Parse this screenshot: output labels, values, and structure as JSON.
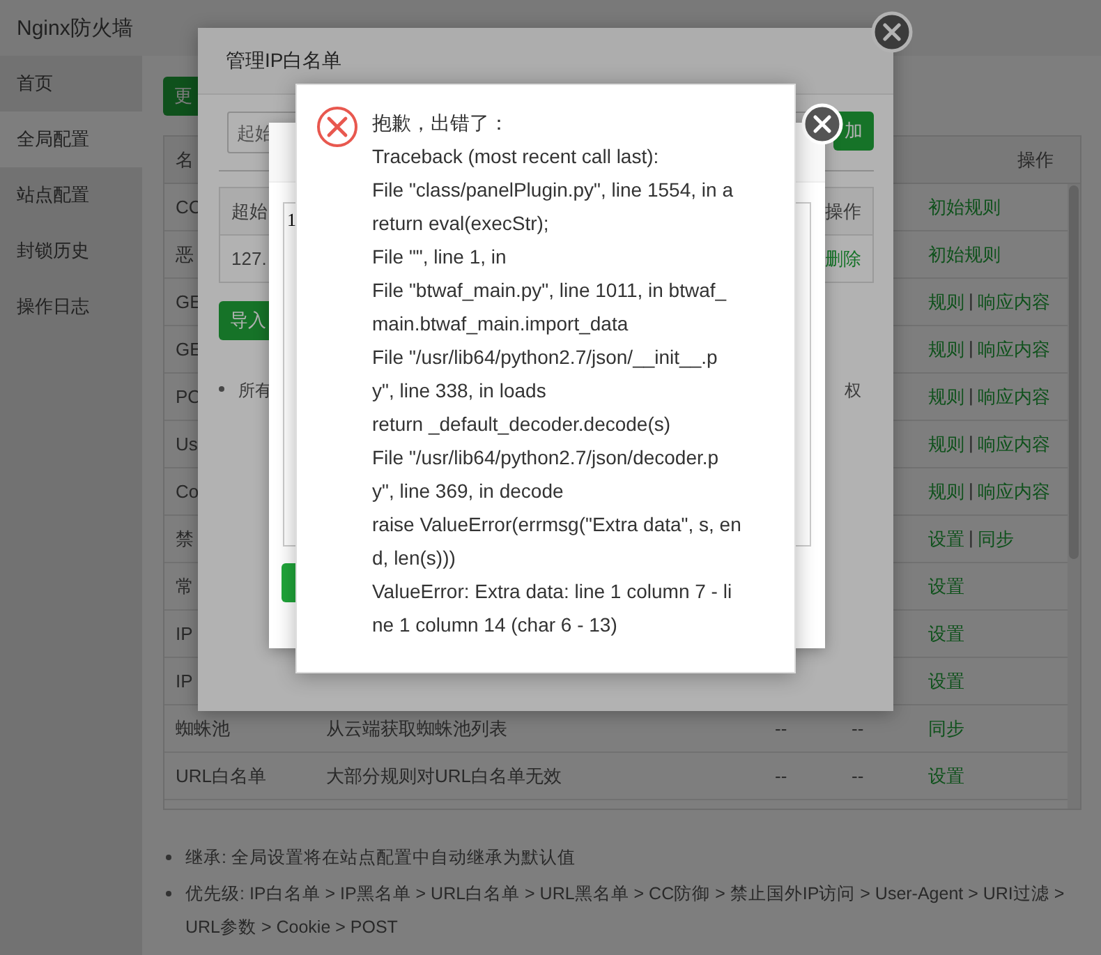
{
  "app_title": "Nginx防火墙",
  "sidebar": {
    "items": [
      {
        "label": "首页",
        "selected": false
      },
      {
        "label": "全局配置",
        "selected": true
      },
      {
        "label": "站点配置",
        "selected": false
      },
      {
        "label": "封锁历史",
        "selected": false
      },
      {
        "label": "操作日志",
        "selected": false
      }
    ]
  },
  "main": {
    "toolbar_button": "更",
    "table": {
      "columns": [
        "名",
        "操作"
      ],
      "rows": [
        {
          "name": "CC",
          "actions": [
            {
              "kind": "link",
              "label": "初始规则"
            }
          ]
        },
        {
          "name": "恶",
          "actions": [
            {
              "kind": "link",
              "label": "初始规则"
            }
          ]
        },
        {
          "name": "GE",
          "actions": [
            {
              "kind": "link",
              "label": "规则"
            },
            {
              "kind": "separator",
              "label": "|"
            },
            {
              "kind": "link",
              "label": "响应内容"
            }
          ]
        },
        {
          "name": "GE",
          "actions": [
            {
              "kind": "link",
              "label": "规则"
            },
            {
              "kind": "separator",
              "label": "|"
            },
            {
              "kind": "link",
              "label": "响应内容"
            }
          ]
        },
        {
          "name": "PO",
          "actions": [
            {
              "kind": "link",
              "label": "规则"
            },
            {
              "kind": "separator",
              "label": "|"
            },
            {
              "kind": "link",
              "label": "响应内容"
            }
          ]
        },
        {
          "name": "Us",
          "actions": [
            {
              "kind": "link",
              "label": "规则"
            },
            {
              "kind": "separator",
              "label": "|"
            },
            {
              "kind": "link",
              "label": "响应内容"
            }
          ]
        },
        {
          "name": "Co",
          "actions": [
            {
              "kind": "link",
              "label": "规则"
            },
            {
              "kind": "separator",
              "label": "|"
            },
            {
              "kind": "link",
              "label": "响应内容"
            }
          ]
        },
        {
          "name": "禁",
          "actions": [
            {
              "kind": "link",
              "label": "设置"
            },
            {
              "kind": "separator",
              "label": "|"
            },
            {
              "kind": "link",
              "label": "同步"
            }
          ]
        },
        {
          "name": "常",
          "actions": [
            {
              "kind": "link",
              "label": "设置"
            }
          ]
        },
        {
          "name": "IP",
          "actions": [
            {
              "kind": "link",
              "label": "设置"
            }
          ]
        },
        {
          "name": "IP",
          "actions": [
            {
              "kind": "link",
              "label": "设置"
            }
          ]
        },
        {
          "name": "蜘蛛池",
          "description": "从云端获取蜘蛛池列表",
          "column_3": "--",
          "column_4": "--",
          "actions": [
            {
              "kind": "link",
              "label": "同步"
            }
          ]
        },
        {
          "name": "URL白名单",
          "description": "大部分规则对URL白名单无效",
          "column_3": "--",
          "column_4": "--",
          "actions": [
            {
              "kind": "link",
              "label": "设置"
            }
          ]
        }
      ]
    },
    "notes": [
      "继承: 全局设置将在站点配置中自动继承为默认值",
      "优先级: IP白名单 > IP黑名单 > URL白名单 > URL黑名单 > CC防御 > 禁止国外IP访问 > User-Agent > URI过滤 > URL参数 > Cookie > POST"
    ]
  },
  "ip_whitelist_dialog": {
    "title": "管理IP白名单",
    "start_ip_placeholder": "起始",
    "add_button": "加",
    "table": {
      "columns": [
        "超始",
        "操作"
      ],
      "rows": [
        {
          "ip": "127.",
          "action": "删除"
        }
      ]
    },
    "import_button": "导入",
    "note_left": "所有",
    "note_right": "权"
  },
  "import_dialog": {
    "textarea_value": "1"
  },
  "error_popup": {
    "title": "抱歉，出错了：",
    "lines": [
      "Traceback (most recent call last):",
      "File \"class/panelPlugin.py\", line 1554, in a",
      "return eval(execStr);",
      "File \"\", line 1, in",
      "File \"btwaf_main.py\", line 1011, in btwaf_",
      "main.btwaf_main.import_data",
      "File \"/usr/lib64/python2.7/json/__init__.p",
      "y\", line 338, in loads",
      "return _default_decoder.decode(s)",
      "File \"/usr/lib64/python2.7/json/decoder.p",
      "y\", line 369, in decode",
      "raise ValueError(errmsg(\"Extra data\", s, en",
      "d, len(s)))",
      "ValueError: Extra data: line 1 column 7 - li",
      "ne 1 column 14 (char 6 - 13)"
    ]
  }
}
